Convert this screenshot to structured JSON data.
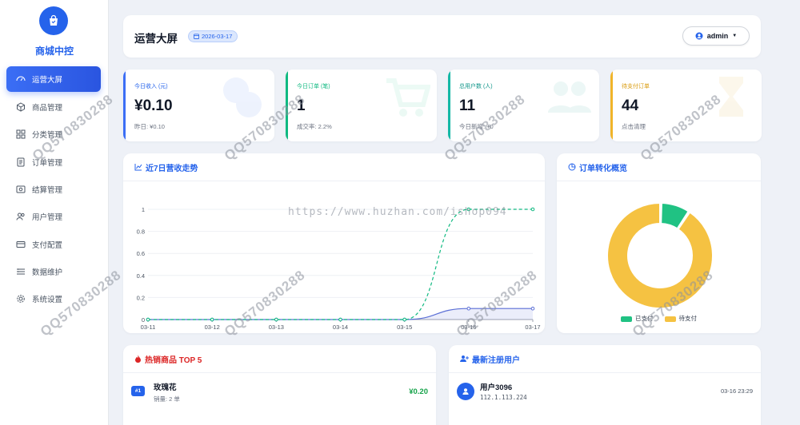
{
  "sidebar": {
    "brand": "商城中控",
    "items": [
      {
        "label": "运营大屏",
        "icon": "dashboard-icon",
        "active": true
      },
      {
        "label": "商品管理",
        "icon": "box-icon"
      },
      {
        "label": "分类管理",
        "icon": "grid-icon"
      },
      {
        "label": "订单管理",
        "icon": "document-icon"
      },
      {
        "label": "结算管理",
        "icon": "settlement-icon"
      },
      {
        "label": "用户管理",
        "icon": "users-icon"
      },
      {
        "label": "支付配置",
        "icon": "card-icon"
      },
      {
        "label": "数据维护",
        "icon": "database-icon"
      },
      {
        "label": "系统设置",
        "icon": "gear-icon"
      }
    ]
  },
  "header": {
    "title": "运营大屏",
    "date": "2026-03-17",
    "user": "admin"
  },
  "stats": [
    {
      "label": "今日收入 (元)",
      "value": "¥0.10",
      "sub": "昨日: ¥0.10",
      "color": "#3b6ef5"
    },
    {
      "label": "今日订单 (笔)",
      "value": "1",
      "sub": "成交率: 2.2%",
      "color": "#10b981"
    },
    {
      "label": "总用户数 (人)",
      "value": "11",
      "sub": "今日新增: +0",
      "color": "#14b8a6"
    },
    {
      "label": "待支付订单",
      "value": "44",
      "sub": "点击清理",
      "color": "#f0b429"
    }
  ],
  "revenue_panel": {
    "title": "近7日营收走势"
  },
  "conversion_panel": {
    "title": "订单转化概览"
  },
  "hot_panel": {
    "title": "热销商品 TOP 5",
    "items": [
      {
        "rank": "#1",
        "name": "玫瑰花",
        "sales": "销量: 2 单",
        "amount": "¥0.20"
      }
    ]
  },
  "users_panel": {
    "title": "最新注册用户",
    "items": [
      {
        "name": "用户3096",
        "ip": "112.1.113.224",
        "time": "03-16 23:29"
      }
    ]
  },
  "watermark": {
    "url": "https://www.huzhan.com/ishop094",
    "qq": "QQ570830288"
  },
  "chart_data": [
    {
      "type": "line",
      "x": [
        "03-11",
        "03-12",
        "03-13",
        "03-14",
        "03-15",
        "03-16",
        "03-17"
      ],
      "series": [
        {
          "values": [
            0,
            0,
            0,
            0,
            0,
            1,
            1
          ],
          "color": "#10b981",
          "style": "dashed"
        },
        {
          "values": [
            0,
            0,
            0,
            0,
            0,
            0.1,
            0.1
          ],
          "color": "#5b6fd6",
          "style": "solid-area"
        }
      ],
      "yticks": [
        "0",
        "0.2",
        "0.4",
        "0.6",
        "0.8",
        "1"
      ],
      "ylim": [
        0,
        1.1
      ],
      "grid": true
    },
    {
      "type": "pie",
      "labels": [
        "已支付",
        "待支付"
      ],
      "values": [
        1,
        10
      ],
      "colors": [
        "#20c283",
        "#f5c242"
      ],
      "legend": "bottom"
    }
  ]
}
